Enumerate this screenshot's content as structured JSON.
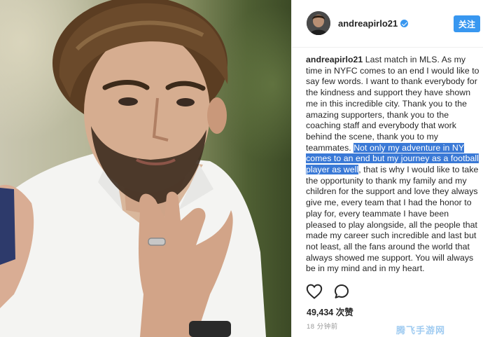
{
  "post": {
    "username": "andreapirlo21",
    "follow_label": "关注",
    "caption": {
      "username": "andreapirlo21",
      "text_before": " Last match in MLS. As my time in NYFC comes to an end I would like to say few words. I want to thank everybody for the kindness and support they have shown me in this incredible city. Thank you to the amazing supporters, thank you to the coaching staff and everybody that work behind the scene, thank you to my teammates. ",
      "highlighted": "Not only my adventure in NY comes to an end but my journey as a football player as well",
      "text_after": ", that is why I would like to take the opportunity to thank my family and my children for the support and love they always give me, every team that I had the honor to play for, every teammate I have been pleased to play alongside, all the people that made my career such incredible and last but not least, all the fans around the world that always showed me support. You will always be in my mind and in my heart."
    },
    "likes": "49,434 次赞",
    "timestamp": "18 分钟前"
  },
  "icons": {
    "verified": "verified-badge-icon",
    "like": "heart-icon",
    "comment": "comment-bubble-icon"
  },
  "colors": {
    "follow_button": "#3897f0",
    "highlight": "#3a79d6",
    "verified": "#3897f0"
  },
  "watermark": "腾飞手游网"
}
